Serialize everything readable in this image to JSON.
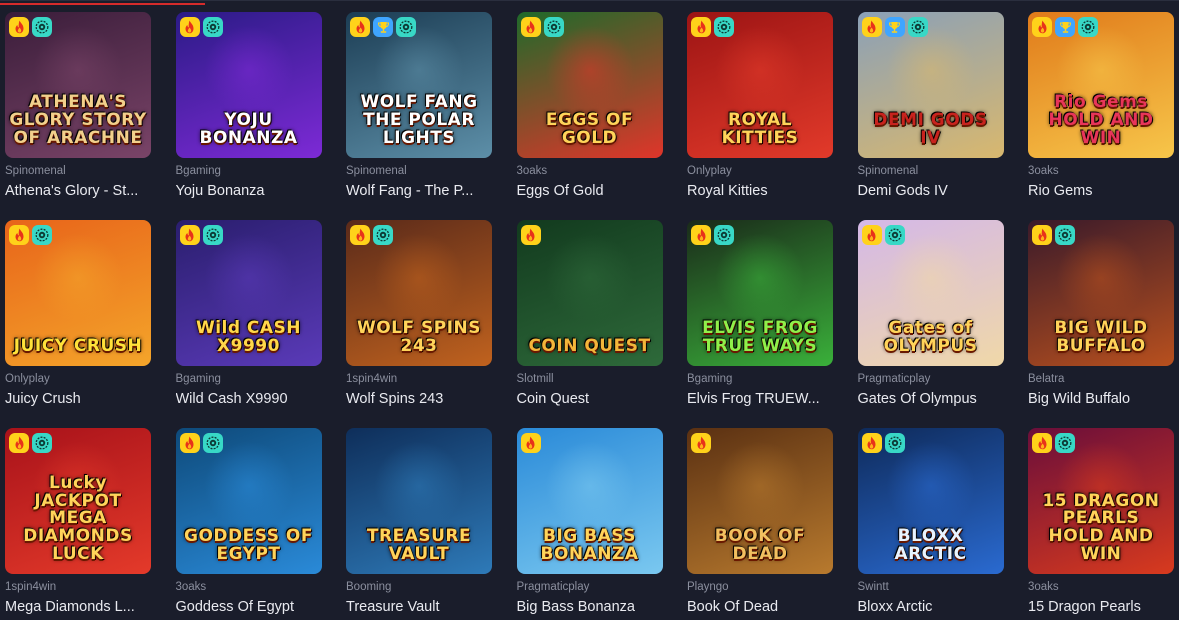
{
  "badge_icons": {
    "hot": "flame-icon",
    "trophy": "trophy-icon",
    "provably": "provably-fair-icon"
  },
  "colors": {
    "background": "#1a1d2b",
    "accent": "#d62b2b",
    "provider_text": "#8b8f9e",
    "name_text": "#e9eaf0",
    "badge_hot": "#ffd21a",
    "badge_trophy": "#3fa5ff",
    "badge_provably": "#38d8c6"
  },
  "games": [
    {
      "provider": "Spinomenal",
      "name": "Athena's Glory - St...",
      "thumb_title": "ATHENA'S GLORY STORY OF ARACHNE",
      "badges": [
        "hot",
        "provably"
      ],
      "bg": [
        "#3a1d3a",
        "#7a4468"
      ],
      "title_color": "#f2d08c"
    },
    {
      "provider": "Bgaming",
      "name": "Yoju Bonanza",
      "thumb_title": "YOJU BONANZA",
      "badges": [
        "hot",
        "provably"
      ],
      "bg": [
        "#2b1b86",
        "#7d2ad6"
      ],
      "title_color": "#ffffff"
    },
    {
      "provider": "Spinomenal",
      "name": "Wolf Fang - The P...",
      "thumb_title": "WOLF FANG THE POLAR LIGHTS",
      "badges": [
        "hot",
        "trophy",
        "provably"
      ],
      "bg": [
        "#1c3d54",
        "#5d8fa8"
      ],
      "title_color": "#ffffff"
    },
    {
      "provider": "3oaks",
      "name": "Eggs Of Gold",
      "thumb_title": "EGGS OF GOLD",
      "badges": [
        "hot",
        "provably"
      ],
      "bg": [
        "#1e6a2a",
        "#e0352a"
      ],
      "title_color": "#ffd45a"
    },
    {
      "provider": "Onlyplay",
      "name": "Royal Kitties",
      "thumb_title": "ROYAL KITTIES",
      "badges": [
        "hot",
        "provably"
      ],
      "bg": [
        "#9c1414",
        "#e23a2a"
      ],
      "title_color": "#ffd45a"
    },
    {
      "provider": "Spinomenal",
      "name": "Demi Gods IV",
      "thumb_title": "DEMI GODS IV",
      "badges": [
        "hot",
        "trophy",
        "provably"
      ],
      "bg": [
        "#8aa0b8",
        "#d9b86e"
      ],
      "title_color": "#c8231e"
    },
    {
      "provider": "3oaks",
      "name": "Rio Gems",
      "thumb_title": "Rio Gems HOLD AND WIN",
      "badges": [
        "hot",
        "trophy",
        "provably"
      ],
      "bg": [
        "#e07a1a",
        "#f7c64a"
      ],
      "title_color": "#e8355a"
    },
    {
      "provider": "Onlyplay",
      "name": "Juicy Crush",
      "thumb_title": "JUICY CRUSH",
      "badges": [
        "hot",
        "provably"
      ],
      "bg": [
        "#e8641a",
        "#f4a52a"
      ],
      "title_color": "#ffe23a"
    },
    {
      "provider": "Bgaming",
      "name": "Wild Cash X9990",
      "thumb_title": "Wild CASH X9990",
      "badges": [
        "hot",
        "provably"
      ],
      "bg": [
        "#2a1e6e",
        "#5a3ab8"
      ],
      "title_color": "#ffd84a"
    },
    {
      "provider": "1spin4win",
      "name": "Wolf Spins 243",
      "thumb_title": "WOLF SPINS 243",
      "badges": [
        "hot",
        "provably"
      ],
      "bg": [
        "#5a2a1a",
        "#c0621e"
      ],
      "title_color": "#ffd45a"
    },
    {
      "provider": "Slotmill",
      "name": "Coin Quest",
      "thumb_title": "COIN QUEST",
      "badges": [
        "hot"
      ],
      "bg": [
        "#123a1e",
        "#2e6a3a"
      ],
      "title_color": "#f2b63a"
    },
    {
      "provider": "Bgaming",
      "name": "Elvis Frog TRUEW...",
      "thumb_title": "ELVIS FROG TRUE WAYS",
      "badges": [
        "hot",
        "provably"
      ],
      "bg": [
        "#1a2a1a",
        "#3ab03a"
      ],
      "title_color": "#8ff04a"
    },
    {
      "provider": "Pragmaticplay",
      "name": "Gates Of Olympus",
      "thumb_title": "Gates of OLYMPUS",
      "badges": [
        "hot",
        "provably"
      ],
      "bg": [
        "#d4b8e8",
        "#f0d8a8"
      ],
      "title_color": "#ffd45a"
    },
    {
      "provider": "Belatra",
      "name": "Big Wild Buffalo",
      "thumb_title": "BIG WILD BUFFALO",
      "badges": [
        "hot",
        "provably"
      ],
      "bg": [
        "#3a1a2a",
        "#b8501e"
      ],
      "title_color": "#ffd45a"
    },
    {
      "provider": "1spin4win",
      "name": "Mega Diamonds L...",
      "thumb_title": "Lucky JACKPOT MEGA DIAMONDS LUCK",
      "badges": [
        "hot",
        "provably"
      ],
      "bg": [
        "#a8121a",
        "#e43a2a"
      ],
      "title_color": "#ffd45a"
    },
    {
      "provider": "3oaks",
      "name": "Goddess Of Egypt",
      "thumb_title": "GODDESS OF EGYPT",
      "badges": [
        "hot",
        "provably"
      ],
      "bg": [
        "#0e4a7a",
        "#2a8ad8"
      ],
      "title_color": "#ffd45a"
    },
    {
      "provider": "Booming",
      "name": "Treasure Vault",
      "thumb_title": "TREASURE VAULT",
      "badges": [],
      "bg": [
        "#0e2e5a",
        "#2e7ab8"
      ],
      "title_color": "#ffd45a"
    },
    {
      "provider": "Pragmaticplay",
      "name": "Big Bass Bonanza",
      "thumb_title": "BIG BASS BONANZA",
      "badges": [
        "hot"
      ],
      "bg": [
        "#2a8ad8",
        "#7ac8f0"
      ],
      "title_color": "#ffd45a"
    },
    {
      "provider": "Playngo",
      "name": "Book Of Dead",
      "thumb_title": "BOOK OF DEAD",
      "badges": [
        "hot"
      ],
      "bg": [
        "#5a3012",
        "#b87a2e"
      ],
      "title_color": "#f2c060"
    },
    {
      "provider": "Swintt",
      "name": "Bloxx Arctic",
      "thumb_title": "BLOXX ARCTIC",
      "badges": [
        "hot",
        "provably"
      ],
      "bg": [
        "#0e2a5a",
        "#2a6ad0"
      ],
      "title_color": "#e8f4ff"
    },
    {
      "provider": "3oaks",
      "name": "15 Dragon Pearls",
      "thumb_title": "15 DRAGON PEARLS HOLD AND WIN",
      "badges": [
        "hot",
        "provably"
      ],
      "bg": [
        "#6a0e3a",
        "#d83a1e"
      ],
      "title_color": "#ffd45a"
    }
  ]
}
